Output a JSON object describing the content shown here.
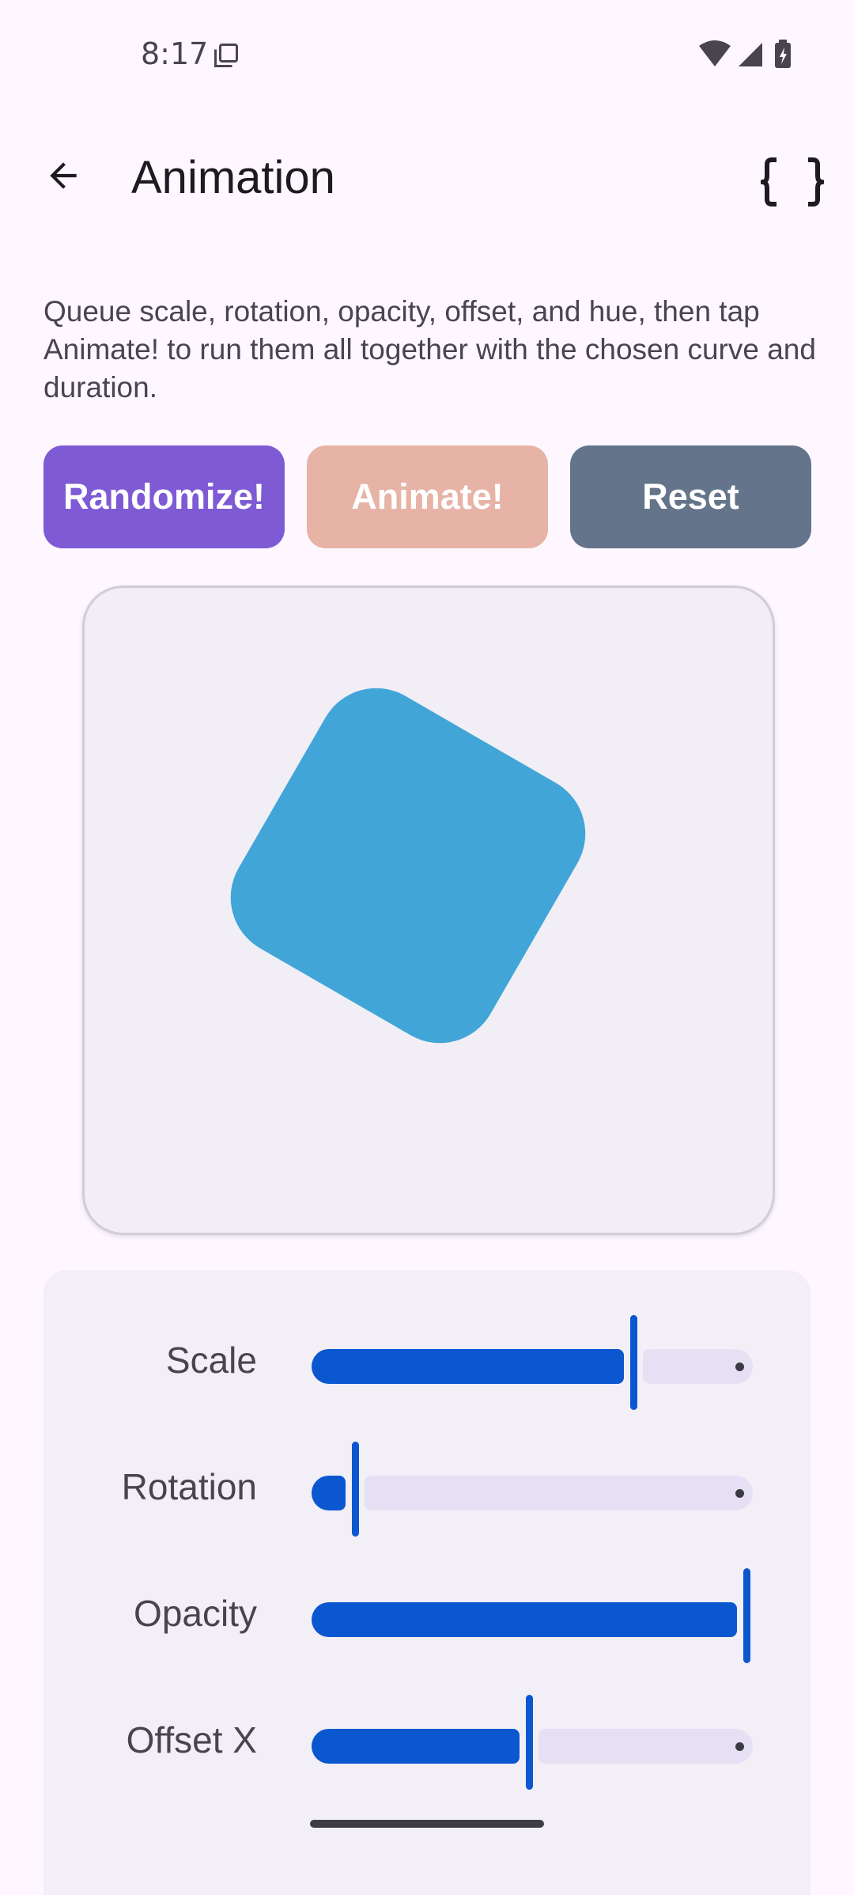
{
  "status": {
    "time": "8:17"
  },
  "app_bar": {
    "title": "Animation"
  },
  "description": "Queue scale, rotation, opacity, offset, and hue, then tap Animate! to run them all together with the chosen curve and duration.",
  "buttons": {
    "randomize": "Randomize!",
    "animate": "Animate!",
    "reset": "Reset"
  },
  "colors": {
    "randomize_bg": "#7E5AD5",
    "animate_bg": "#E6B3A6",
    "reset_bg": "#64748B",
    "shape": "#41A6D7",
    "slider_active": "#0B57D0"
  },
  "sliders": [
    {
      "label": "Scale",
      "fraction": 0.74
    },
    {
      "label": "Rotation",
      "fraction": 0.1
    },
    {
      "label": "Opacity",
      "fraction": 1.0
    },
    {
      "label": "Offset X",
      "fraction": 0.5
    }
  ]
}
